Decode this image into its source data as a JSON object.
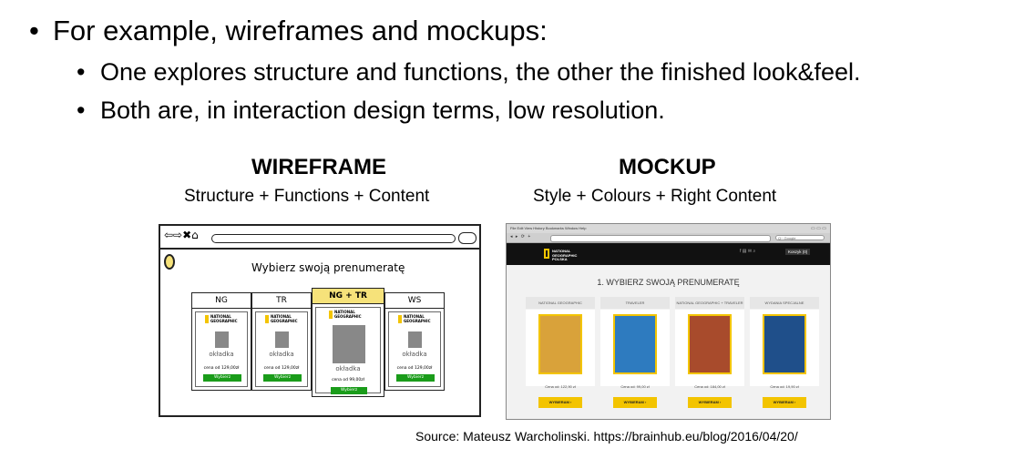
{
  "bullets": [
    "For example, wireframes and mockups:",
    "One explores structure and functions, the other the finished look&feel.",
    "Both are, in interaction design terms, low resolution."
  ],
  "bullet_glyph": "•",
  "wireframe": {
    "title": "WIREFRAME",
    "subtitle": "Structure + Functions + Content",
    "nav_icons": "⇦⇨✖⌂",
    "heading": "Wybierz swoją prenumeratę",
    "brand": "NATIONAL\nGEOGRAPHIC",
    "cards": [
      {
        "name": "NG",
        "cover": "okładka",
        "price": "cena od 129,00zł",
        "button": "Wybierz"
      },
      {
        "name": "TR",
        "cover": "okładka",
        "price": "cena od 129,00zł",
        "button": "Wybierz"
      },
      {
        "name": "NG + TR",
        "cover": "okładka",
        "price": "cena od 99,00zł",
        "button": "Wybierz"
      },
      {
        "name": "WS",
        "cover": "okładka",
        "price": "cena od 129,00zł",
        "button": "Wybierz"
      }
    ]
  },
  "mockup": {
    "title": "MOCKUP",
    "subtitle": "Style + Colours + Right Content",
    "browser_menu": "File  Edit  View  History  Bookmarks  Window  Help",
    "window_controls": "▭ ▭ ▭",
    "nav_buttons": "◂ ▸ ⟳ +",
    "search_placeholder": "Q~ Google",
    "brand": "NATIONAL\nGEOGRAPHIC\nPOLSKA",
    "header_icons": "f   ▤   ✉   ⌕",
    "cart": "Koszyk (0)",
    "heading": "1. WYBIERZ SWOJĄ PRENUMERATĘ",
    "columns": [
      {
        "name": "NATIONAL GEOGRAPHIC",
        "price": "Cena od: 122,90 zł",
        "button": "WYBIERAM  ›",
        "cover_color": "#d9a23a"
      },
      {
        "name": "TRAVELER",
        "price": "Cena od: 99,00 zł",
        "button": "WYBIERAM  ›",
        "cover_color": "#2e7bbf"
      },
      {
        "name": "NATIONAL GEOGRAPHIC + TRAVELER",
        "price": "Cena od: 184,00 zł",
        "button": "WYBIERAM  ›",
        "cover_color": "#a84b2c"
      },
      {
        "name": "WYDANIA SPECJALNE",
        "price": "Cena od: 19,90 zł",
        "button": "WYBIERAM  ›",
        "cover_color": "#1f4f8a"
      }
    ]
  },
  "source": "Source: Mateusz Warcholinski. https://brainhub.eu/blog/2016/04/20/"
}
